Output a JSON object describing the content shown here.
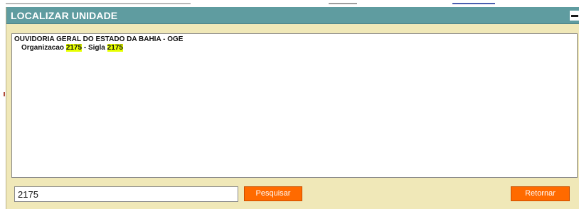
{
  "dialog": {
    "title": "LOCALIZAR UNIDADE"
  },
  "results": {
    "items": [
      {
        "name": "OUVIDORIA GERAL DO ESTADO DA BAHIA - OGE",
        "org_label": "Organizacao",
        "org_code": "2175",
        "separator": "-",
        "sigla_label": "Sigla",
        "sigla_code": "2175"
      }
    ]
  },
  "search": {
    "value": "2175",
    "button_label": "Pesquisar"
  },
  "actions": {
    "return_label": "Retornar"
  },
  "colors": {
    "titlebar": "#5f9ca0",
    "dialog_bg": "#f0e8b8",
    "button": "#ff6a00",
    "highlight": "#e6ff00"
  }
}
